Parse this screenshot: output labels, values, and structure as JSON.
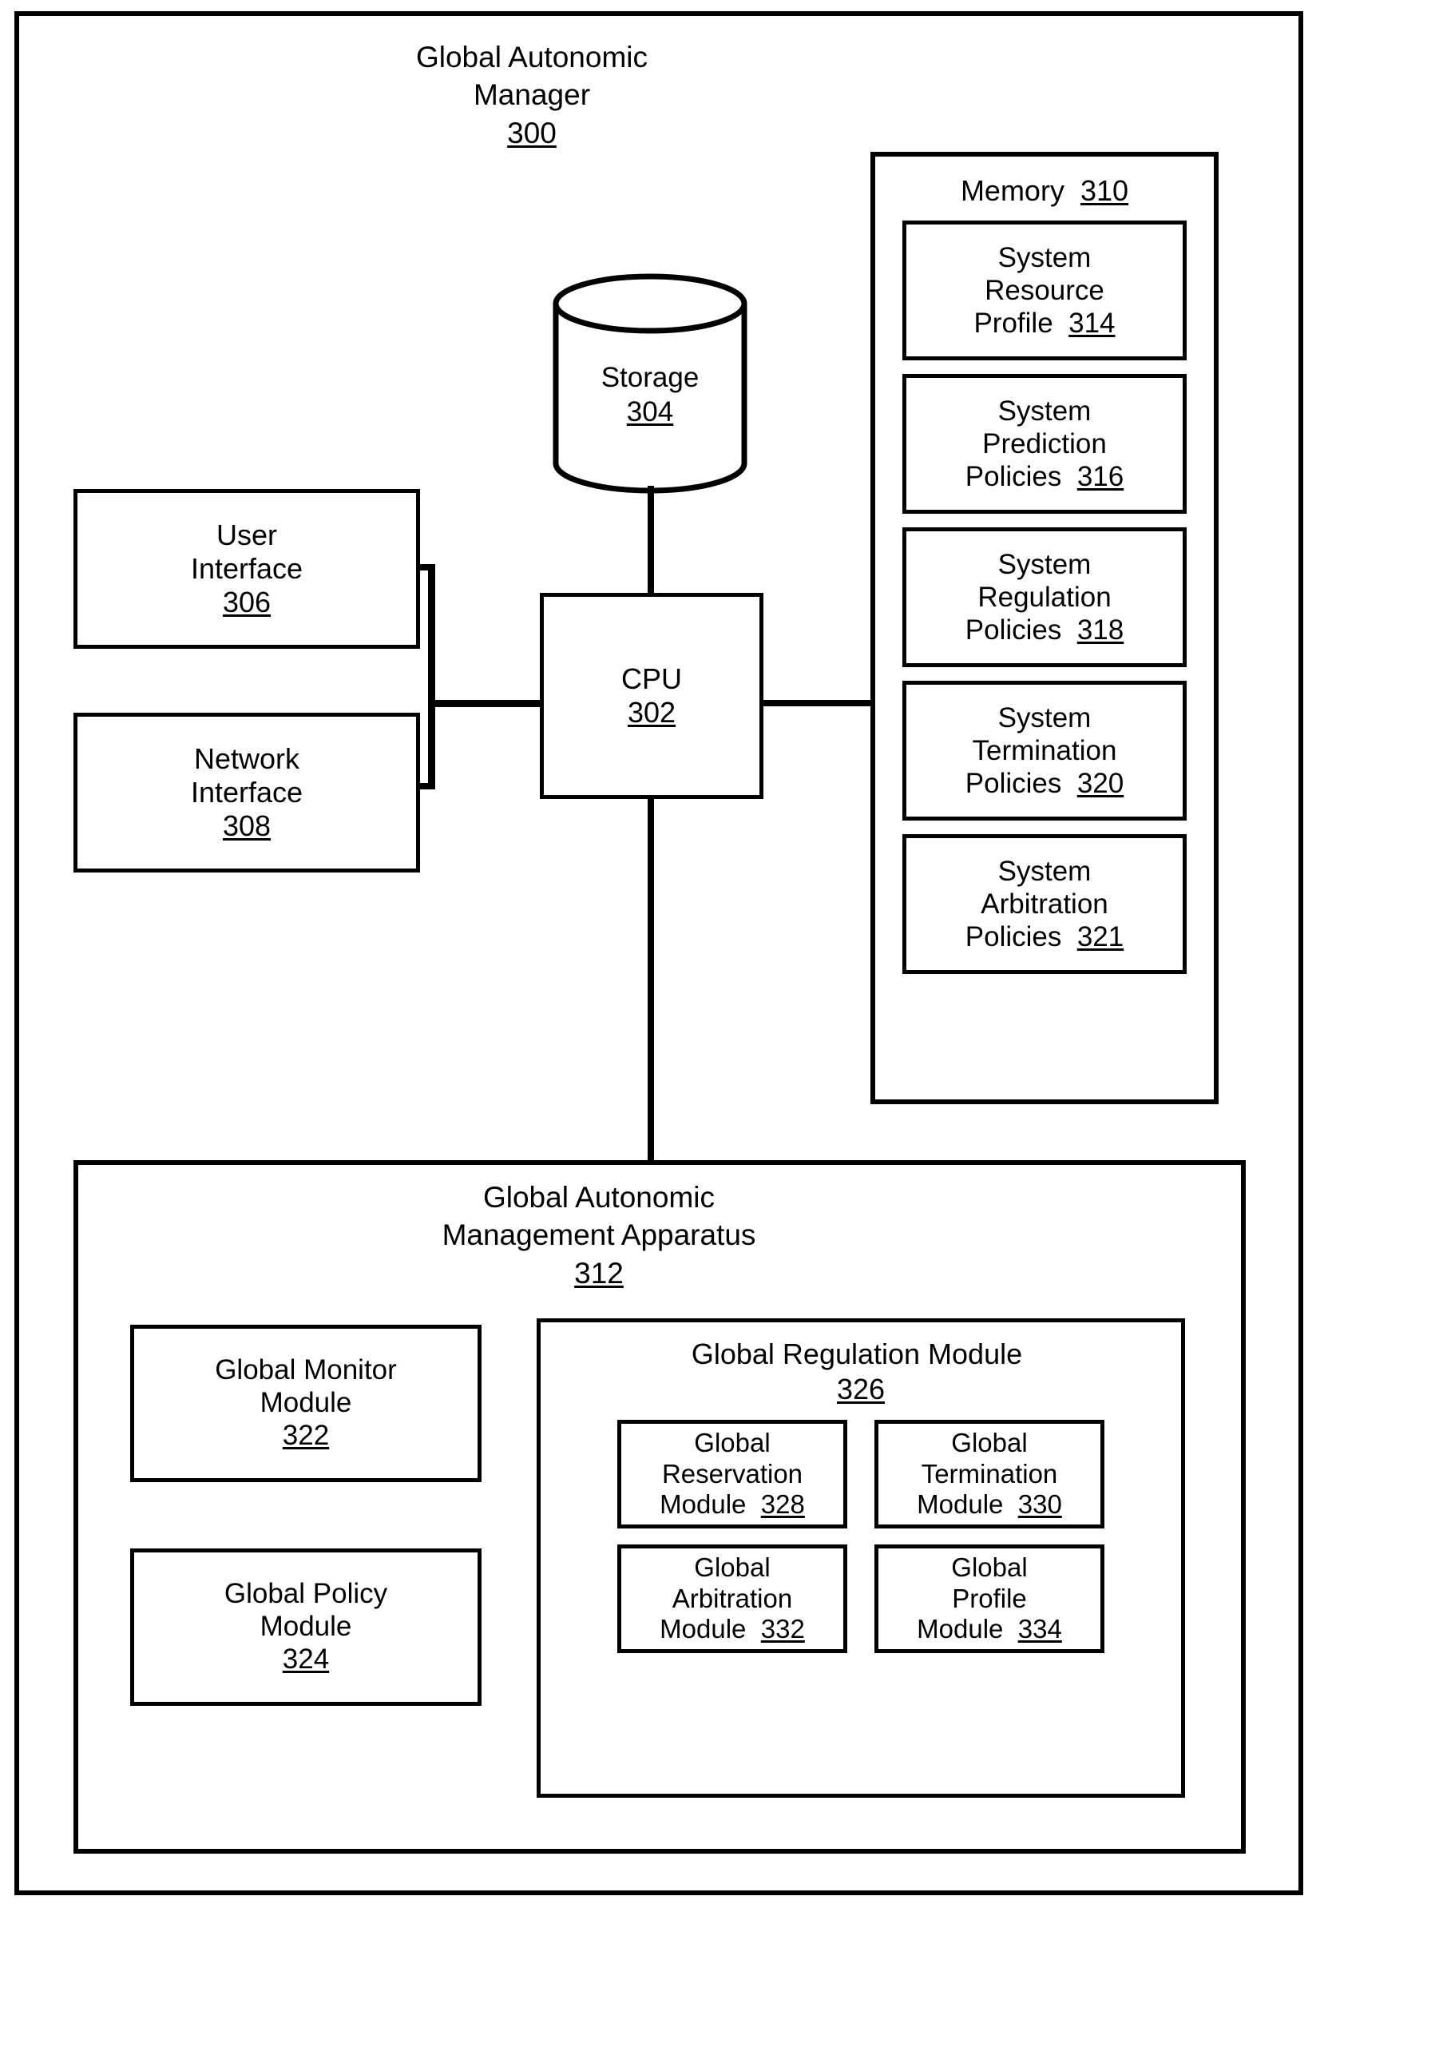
{
  "diagram": {
    "title_line1": "Global Autonomic",
    "title_line2": "Manager",
    "title_ref": "300"
  },
  "storage": {
    "label": "Storage",
    "ref": "304",
    "icon": "database-cylinder-icon"
  },
  "cpu": {
    "label": "CPU",
    "ref": "302"
  },
  "user_interface": {
    "line1": "User",
    "line2": "Interface",
    "ref": "306"
  },
  "network_interface": {
    "line1": "Network",
    "line2": "Interface",
    "ref": "308"
  },
  "memory": {
    "heading": "Memory",
    "heading_ref": "310",
    "items": [
      {
        "line1": "System",
        "line2": "Resource",
        "line3": "Profile",
        "ref": "314"
      },
      {
        "line1": "System",
        "line2": "Prediction",
        "line3": "Policies",
        "ref": "316"
      },
      {
        "line1": "System",
        "line2": "Regulation",
        "line3": "Policies",
        "ref": "318"
      },
      {
        "line1": "System",
        "line2": "Termination",
        "line3": "Policies",
        "ref": "320"
      },
      {
        "line1": "System",
        "line2": "Arbitration",
        "line3": "Policies",
        "ref": "321"
      }
    ]
  },
  "apparatus": {
    "title_line1": "Global Autonomic",
    "title_line2": "Management Apparatus",
    "title_ref": "312",
    "monitor_module": {
      "line1": "Global Monitor",
      "line2": "Module",
      "ref": "322"
    },
    "policy_module": {
      "line1": "Global Policy",
      "line2": "Module",
      "ref": "324"
    },
    "regulation_module": {
      "heading": "Global Regulation Module",
      "heading_ref": "326",
      "submodules": [
        {
          "line1": "Global",
          "line2": "Reservation",
          "line3": "Module",
          "ref": "328"
        },
        {
          "line1": "Global",
          "line2": "Termination",
          "line3": "Module",
          "ref": "330"
        },
        {
          "line1": "Global",
          "line2": "Arbitration",
          "line3": "Module",
          "ref": "332"
        },
        {
          "line1": "Global",
          "line2": "Profile",
          "line3": "Module",
          "ref": "334"
        }
      ]
    }
  },
  "colors": {
    "stroke": "#000000",
    "background": "#ffffff"
  }
}
